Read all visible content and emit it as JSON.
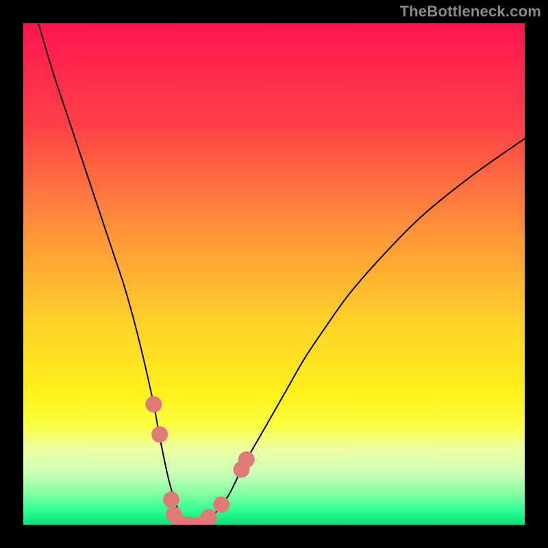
{
  "watermark": "TheBottleneck.com",
  "chart_data": {
    "type": "line",
    "title": "",
    "xlabel": "",
    "ylabel": "",
    "xlim": [
      0,
      100
    ],
    "ylim": [
      0,
      100
    ],
    "grid": false,
    "legend": false,
    "gradient_stops": [
      {
        "offset": 0,
        "color": "#ff1551"
      },
      {
        "offset": 20,
        "color": "#ff3f48"
      },
      {
        "offset": 40,
        "color": "#ff8e3a"
      },
      {
        "offset": 60,
        "color": "#ffd228"
      },
      {
        "offset": 74,
        "color": "#fff11b"
      },
      {
        "offset": 80,
        "color": "#faff3f"
      },
      {
        "offset": 85,
        "color": "#edffa2"
      },
      {
        "offset": 90,
        "color": "#c8ffb6"
      },
      {
        "offset": 94,
        "color": "#7fff9f"
      },
      {
        "offset": 97,
        "color": "#33ff95"
      },
      {
        "offset": 100,
        "color": "#00e57a"
      }
    ],
    "series": [
      {
        "name": "bottleneck-curve",
        "x": [
          3,
          6,
          9,
          12,
          15,
          18,
          20,
          22,
          24,
          26,
          27.5,
          29,
          30.5,
          32,
          34,
          36,
          38,
          41,
          44,
          48,
          52,
          56,
          60,
          65,
          72,
          80,
          90,
          100
        ],
        "y": [
          100,
          90,
          81,
          72,
          63,
          54,
          48,
          41,
          33,
          24,
          16,
          9,
          4,
          1,
          0,
          0,
          2,
          6,
          12,
          19,
          26,
          33,
          39,
          46,
          54,
          62,
          70,
          77
        ]
      }
    ],
    "markers": {
      "color": "#e07a78",
      "radius_px": 12,
      "points": [
        {
          "x": 26.0,
          "y": 24
        },
        {
          "x": 27.2,
          "y": 18
        },
        {
          "x": 29.5,
          "y": 5
        },
        {
          "x": 30.0,
          "y": 2
        },
        {
          "x": 31.0,
          "y": 0.5
        },
        {
          "x": 33.0,
          "y": 0
        },
        {
          "x": 35.0,
          "y": 0
        },
        {
          "x": 37.0,
          "y": 1.5
        },
        {
          "x": 39.5,
          "y": 4
        },
        {
          "x": 43.5,
          "y": 11
        },
        {
          "x": 44.5,
          "y": 13
        }
      ]
    }
  }
}
